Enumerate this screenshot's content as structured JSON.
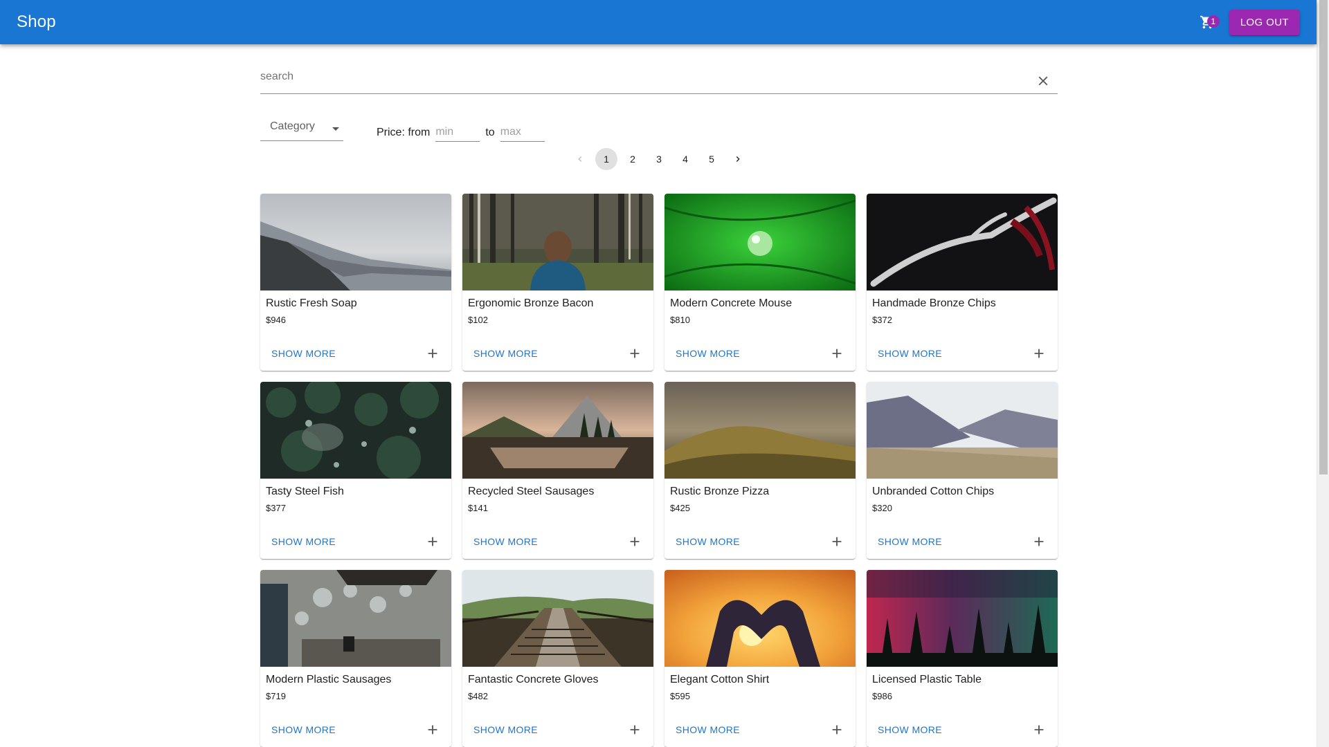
{
  "header": {
    "title": "Shop",
    "cart_count": "1",
    "logout_label": "LOG OUT"
  },
  "search": {
    "placeholder": "search"
  },
  "filters": {
    "category_label": "Category",
    "price_label": "Price: from",
    "min_placeholder": "min",
    "to_label": "to",
    "max_placeholder": "max"
  },
  "pagination": {
    "current": 1,
    "pages": [
      "1",
      "2",
      "3",
      "4",
      "5"
    ]
  },
  "products": [
    {
      "name": "Rustic Fresh Soap",
      "price": "$946",
      "action": "SHOW MORE",
      "image": "mountain-lake"
    },
    {
      "name": "Ergonomic Bronze Bacon",
      "price": "$102",
      "action": "SHOW MORE",
      "image": "forest-person"
    },
    {
      "name": "Modern Concrete Mouse",
      "price": "$810",
      "action": "SHOW MORE",
      "image": "water-drop-leaf"
    },
    {
      "name": "Handmade Bronze Chips",
      "price": "$372",
      "action": "SHOW MORE",
      "image": "antler-dark"
    },
    {
      "name": "Tasty Steel Fish",
      "price": "$377",
      "action": "SHOW MORE",
      "image": "pine-forest"
    },
    {
      "name": "Recycled Steel Sausages",
      "price": "$141",
      "action": "SHOW MORE",
      "image": "mountain-reflection"
    },
    {
      "name": "Rustic Bronze Pizza",
      "price": "$425",
      "action": "SHOW MORE",
      "image": "foggy-hills"
    },
    {
      "name": "Unbranded Cotton Chips",
      "price": "$320",
      "action": "SHOW MORE",
      "image": "mountain-valley"
    },
    {
      "name": "Modern Plastic Sausages",
      "price": "$719",
      "action": "SHOW MORE",
      "image": "bokeh-interior"
    },
    {
      "name": "Fantastic Concrete Gloves",
      "price": "$482",
      "action": "SHOW MORE",
      "image": "railway-bridge"
    },
    {
      "name": "Elegant Cotton Shirt",
      "price": "$595",
      "action": "SHOW MORE",
      "image": "heart-hands-sunset"
    },
    {
      "name": "Licensed Plastic Table",
      "price": "$986",
      "action": "SHOW MORE",
      "image": "aurora-trees"
    }
  ],
  "colors": {
    "primary": "#1976d2",
    "secondary": "#9c27b0"
  }
}
